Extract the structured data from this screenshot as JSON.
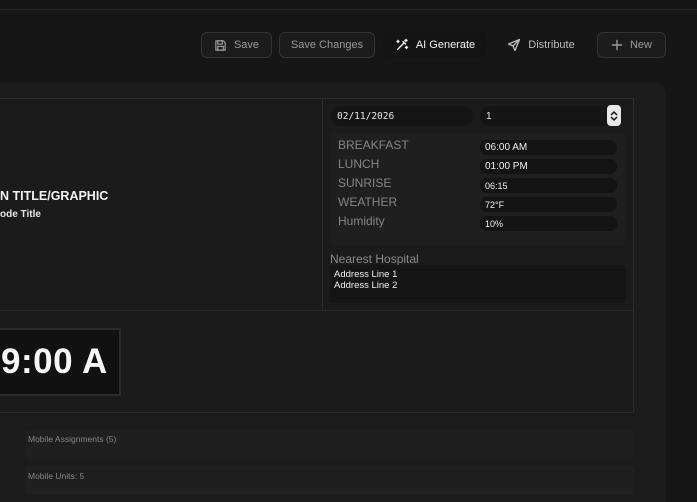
{
  "toolbar": {
    "save": "Save",
    "save_changes": "Save Changes",
    "ai_generate": "AI Generate",
    "distribute": "Distribute",
    "new": "New"
  },
  "main": {
    "title": "N TITLE/GRAPHIC",
    "subtitle": "ode Title",
    "clock": "9:00 A"
  },
  "info": {
    "date": "02/11/2026",
    "number": "1",
    "rows": [
      {
        "label": "BREAKFAST",
        "value": "06:00 AM"
      },
      {
        "label": "LUNCH",
        "value": "01:00 PM"
      },
      {
        "label": "SUNRISE",
        "value": "06:15"
      },
      {
        "label": "WEATHER",
        "value": "72°F"
      },
      {
        "label": "Humidity",
        "value": "10%"
      }
    ],
    "hospital_label": "Nearest Hospital",
    "hospital_lines": [
      "Address Line 1",
      "Address Line 2"
    ]
  },
  "mobile": {
    "assignments": "Mobile Assignments (5)",
    "units": "Mobile Units: 5"
  }
}
